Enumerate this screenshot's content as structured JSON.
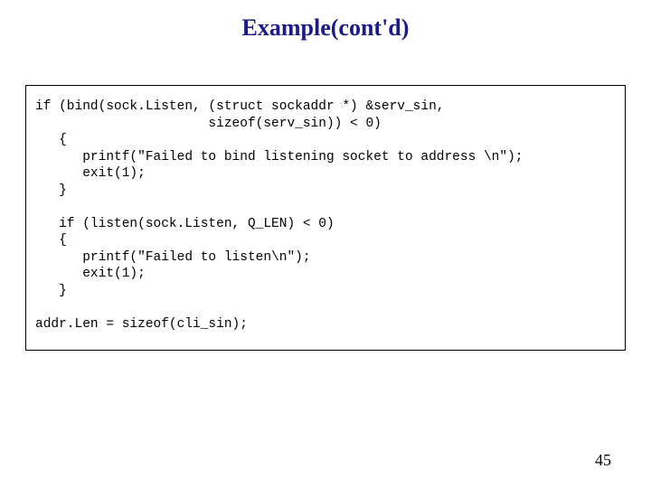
{
  "title": "Example(cont'd)",
  "code": "if (bind(sock.Listen, (struct sockaddr *) &serv_sin,\n                      sizeof(serv_sin)) < 0)\n   {\n      printf(\"Failed to bind listening socket to address \\n\");\n      exit(1);\n   }\n\n   if (listen(sock.Listen, Q_LEN) < 0)\n   {\n      printf(\"Failed to listen\\n\");\n      exit(1);\n   }\n\naddr.Len = sizeof(cli_sin);",
  "page_number": "45"
}
